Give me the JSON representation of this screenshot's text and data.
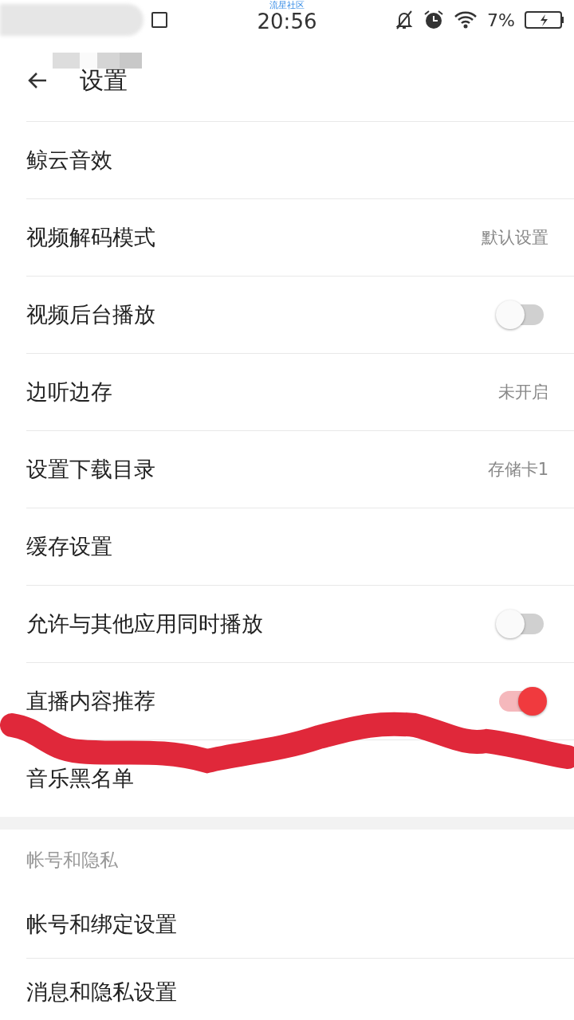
{
  "status_bar": {
    "carrier_note": "流星社区",
    "time": "20:56",
    "battery": "7%"
  },
  "header": {
    "title": "设置"
  },
  "rows": [
    {
      "kind": "plain",
      "label": "鲸云音效"
    },
    {
      "kind": "value",
      "label": "视频解码模式",
      "value": "默认设置"
    },
    {
      "kind": "toggle",
      "label": "视频后台播放",
      "on": false
    },
    {
      "kind": "value",
      "label": "边听边存",
      "value": "未开启"
    },
    {
      "kind": "value",
      "label": "设置下载目录",
      "value": "存储卡1"
    },
    {
      "kind": "plain",
      "label": "缓存设置"
    },
    {
      "kind": "toggle",
      "label": "允许与其他应用同时播放",
      "on": false
    },
    {
      "kind": "toggle",
      "label": "直播内容推荐",
      "on": true
    },
    {
      "kind": "plain",
      "label": "音乐黑名单"
    }
  ],
  "section": {
    "title": "帐号和隐私",
    "rows": [
      {
        "label": "帐号和绑定设置"
      },
      {
        "label": "消息和隐私设置"
      }
    ]
  }
}
